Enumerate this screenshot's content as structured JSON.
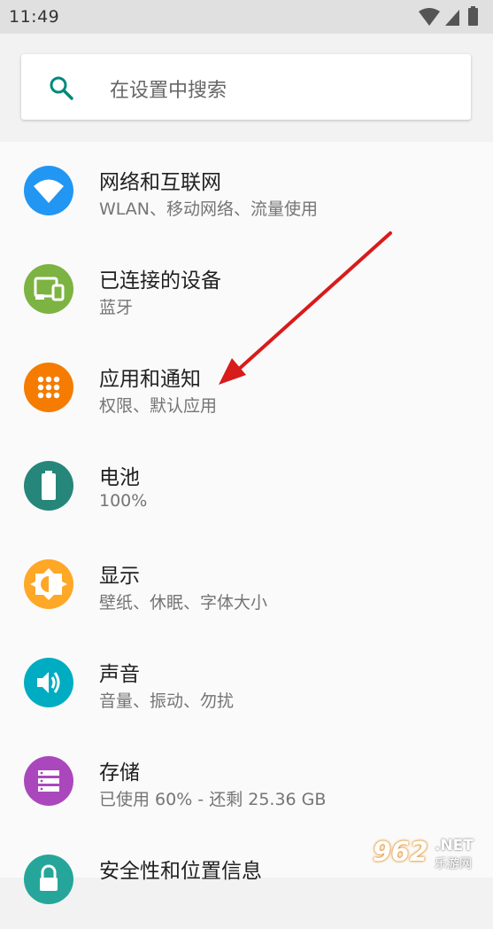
{
  "status_bar": {
    "time": "11:49"
  },
  "search": {
    "placeholder": "在设置中搜索"
  },
  "items": [
    {
      "title": "网络和互联网",
      "subtitle": "WLAN、移动网络、流量使用",
      "icon": "wifi-icon",
      "color": "#2196f3"
    },
    {
      "title": "已连接的设备",
      "subtitle": "蓝牙",
      "icon": "devices-icon",
      "color": "#7cb342"
    },
    {
      "title": "应用和通知",
      "subtitle": "权限、默认应用",
      "icon": "apps-icon",
      "color": "#f57c00"
    },
    {
      "title": "电池",
      "subtitle": "100%",
      "icon": "battery-icon",
      "color": "#26867a"
    },
    {
      "title": "显示",
      "subtitle": "壁纸、休眠、字体大小",
      "icon": "brightness-icon",
      "color": "#ffa726"
    },
    {
      "title": "声音",
      "subtitle": "音量、振动、勿扰",
      "icon": "volume-icon",
      "color": "#00acc1"
    },
    {
      "title": "存储",
      "subtitle": "已使用 60% - 还剩 25.36 GB",
      "icon": "storage-icon",
      "color": "#ab47bc"
    },
    {
      "title": "安全性和位置信息",
      "subtitle": "",
      "icon": "lock-icon",
      "color": "#26a69a"
    }
  ],
  "watermark": {
    "logo": "962",
    "domain": ".NET",
    "name": "乐游网"
  }
}
